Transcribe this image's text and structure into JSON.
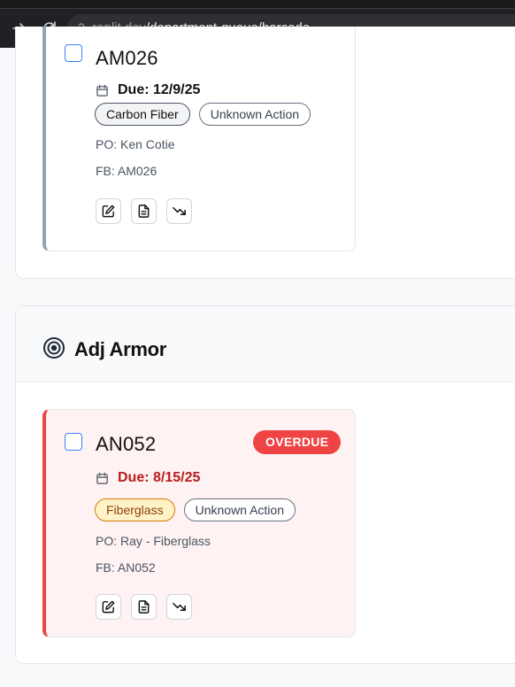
{
  "browser": {
    "url_host": ".replit.dev",
    "url_path": "/department-queue/barcode"
  },
  "sections": [
    {
      "title": "",
      "cards": [
        {
          "id": "AM026",
          "due": "Due: 12/9/25",
          "overdue": false,
          "tags": [
            "Carbon Fiber",
            "Unknown Action"
          ],
          "po": "PO: Ken Cotie",
          "fb": "FB: AM026"
        }
      ]
    },
    {
      "title": "Adj Armor",
      "icon": "target-icon",
      "cards": [
        {
          "id": "AN052",
          "badge": "OVERDUE",
          "due": "Due: 8/15/25",
          "overdue": true,
          "tags": [
            "Fiberglass",
            "Unknown Action"
          ],
          "po": "PO: Ray - Fiberglass",
          "fb": "FB: AN052"
        }
      ]
    }
  ],
  "colors": {
    "overdue_accent": "#ef4444",
    "normal_accent": "#94a3b8",
    "checkbox_border": "#3b82f6",
    "fiberglass_tag": "#d97706"
  }
}
